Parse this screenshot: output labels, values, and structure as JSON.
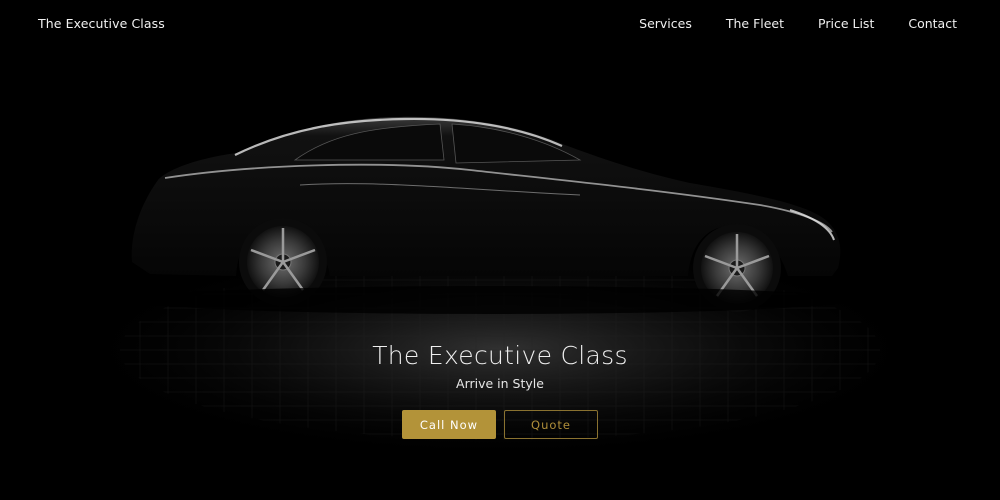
{
  "nav": {
    "brand": "The Executive Class",
    "items": [
      {
        "label": "Services"
      },
      {
        "label": "The Fleet"
      },
      {
        "label": "Price List"
      },
      {
        "label": "Contact"
      }
    ]
  },
  "hero": {
    "title": "The Executive Class",
    "subtitle": "Arrive in Style",
    "primary_cta": "Call Now",
    "secondary_cta": "Quote"
  },
  "colors": {
    "background": "#000000",
    "accent_gold": "#b39339",
    "text": "#efefef"
  }
}
